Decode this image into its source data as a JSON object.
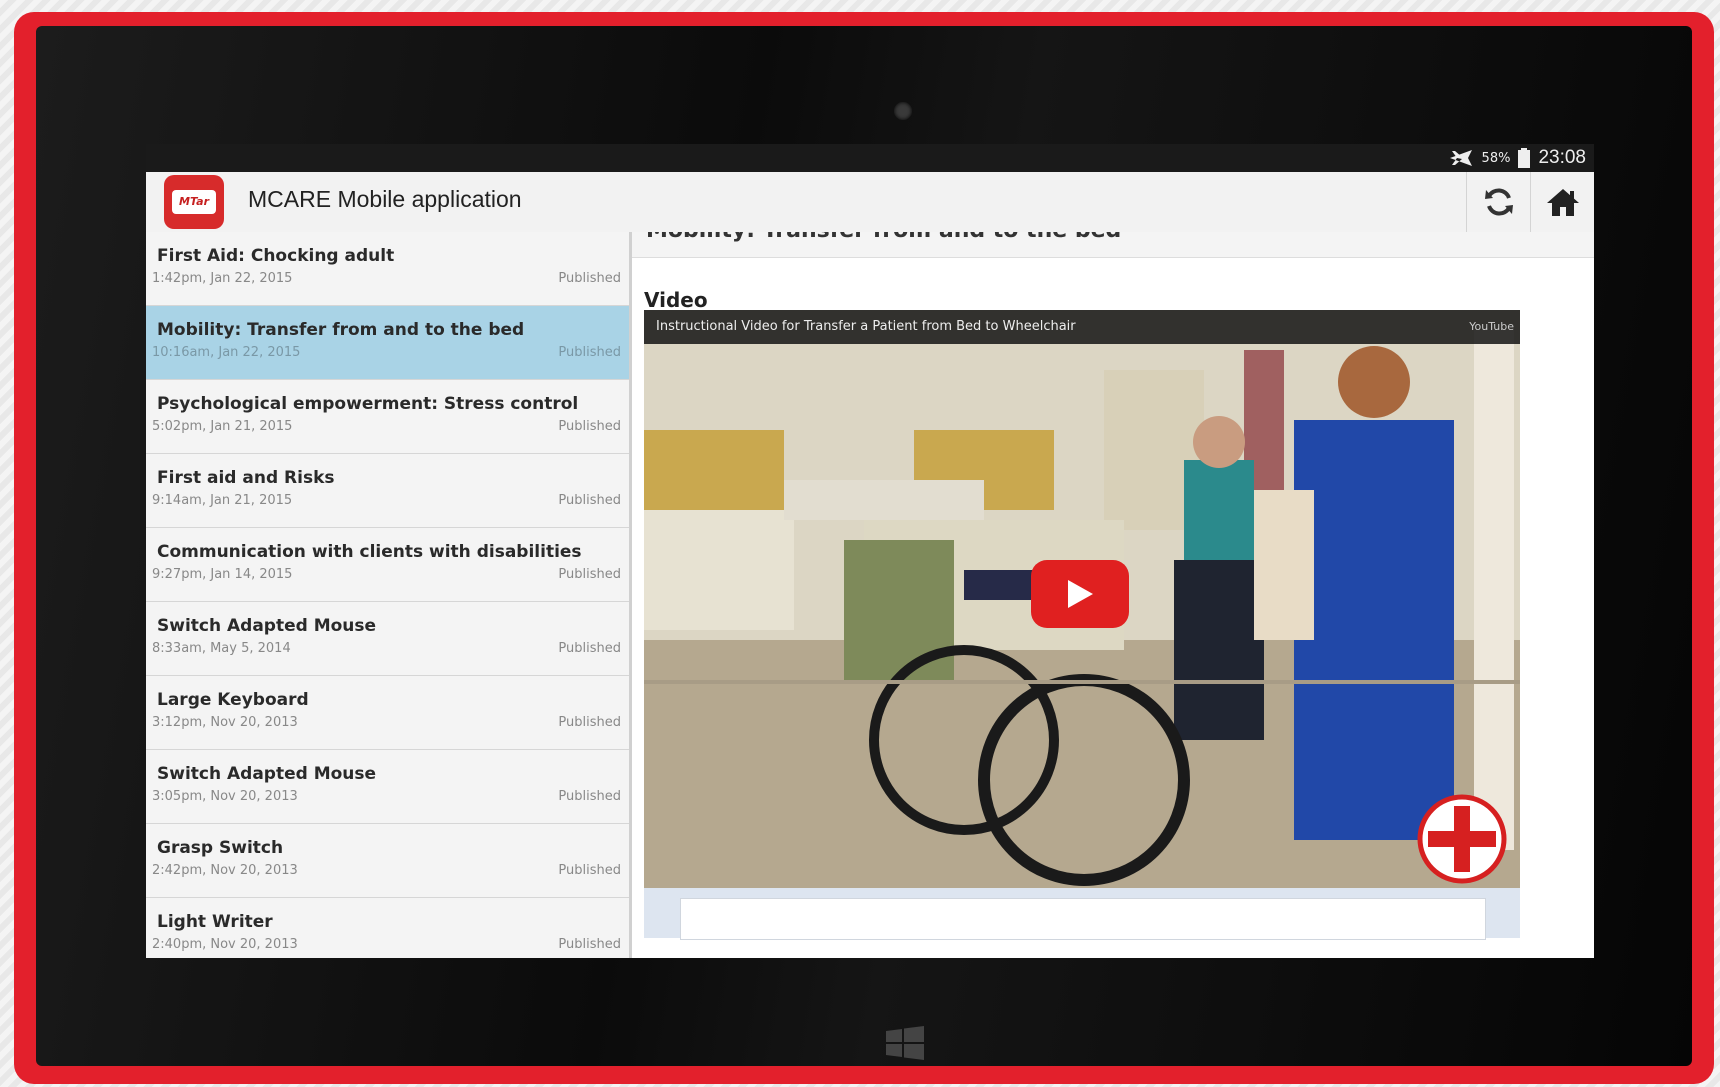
{
  "status_bar": {
    "battery": "58%",
    "time": "23:08",
    "icons": [
      "airplane-icon",
      "battery-icon"
    ]
  },
  "app_bar": {
    "logo_text": "MTar",
    "title": "MCARE Mobile application",
    "actions": [
      "refresh-icon",
      "home-icon"
    ]
  },
  "sidebar": {
    "items": [
      {
        "title": "First Aid: Chocking adult",
        "date": "1:42pm, Jan 22, 2015",
        "status": "Published",
        "selected": false
      },
      {
        "title": "Mobility: Transfer from and to the bed",
        "date": "10:16am, Jan 22, 2015",
        "status": "Published",
        "selected": true
      },
      {
        "title": "Psychological empowerment: Stress control",
        "date": "5:02pm, Jan 21, 2015",
        "status": "Published",
        "selected": false
      },
      {
        "title": "First aid and Risks",
        "date": "9:14am, Jan 21, 2015",
        "status": "Published",
        "selected": false
      },
      {
        "title": "Communication with clients with disabilities",
        "date": "9:27pm, Jan 14, 2015",
        "status": "Published",
        "selected": false
      },
      {
        "title": "Switch Adapted Mouse",
        "date": "8:33am, May 5, 2014",
        "status": "Published",
        "selected": false
      },
      {
        "title": "Large Keyboard",
        "date": "3:12pm, Nov 20, 2013",
        "status": "Published",
        "selected": false
      },
      {
        "title": "Switch Adapted Mouse",
        "date": "3:05pm, Nov 20, 2013",
        "status": "Published",
        "selected": false
      },
      {
        "title": "Grasp Switch",
        "date": "2:42pm, Nov 20, 2013",
        "status": "Published",
        "selected": false
      },
      {
        "title": "Light Writer",
        "date": "2:40pm, Nov 20, 2013",
        "status": "Published",
        "selected": false
      }
    ]
  },
  "content": {
    "cut_title": "Mobility: Transfer from and to the bed",
    "section_label": "Video",
    "video": {
      "title": "Instructional Video for Transfer a Patient from Bed to Wheelchair",
      "provider": "YouTube"
    }
  },
  "colors": {
    "tablet_frame": "#e3202c",
    "selected_row": "#a9d3e6",
    "play_button": "#e02020"
  }
}
